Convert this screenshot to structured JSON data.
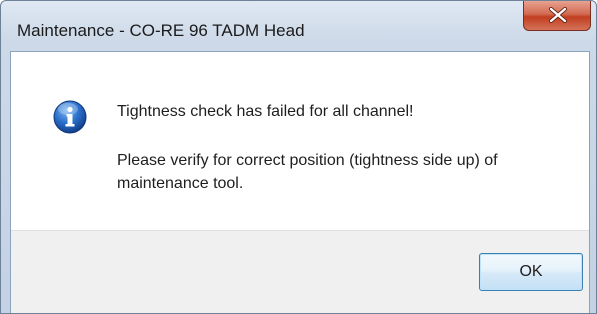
{
  "window": {
    "title": "Maintenance - CO-RE 96 TADM Head",
    "close_icon": "close-icon"
  },
  "message": {
    "icon": "info-icon",
    "line1": "Tightness check has failed for all channel!",
    "line2": "Please verify for correct position (tightness side up) of maintenance tool."
  },
  "buttons": {
    "ok_label": "OK"
  },
  "colors": {
    "close_button": "#c23e1f",
    "info_icon": "#1f5fb8",
    "ok_border": "#3c7fb1"
  }
}
